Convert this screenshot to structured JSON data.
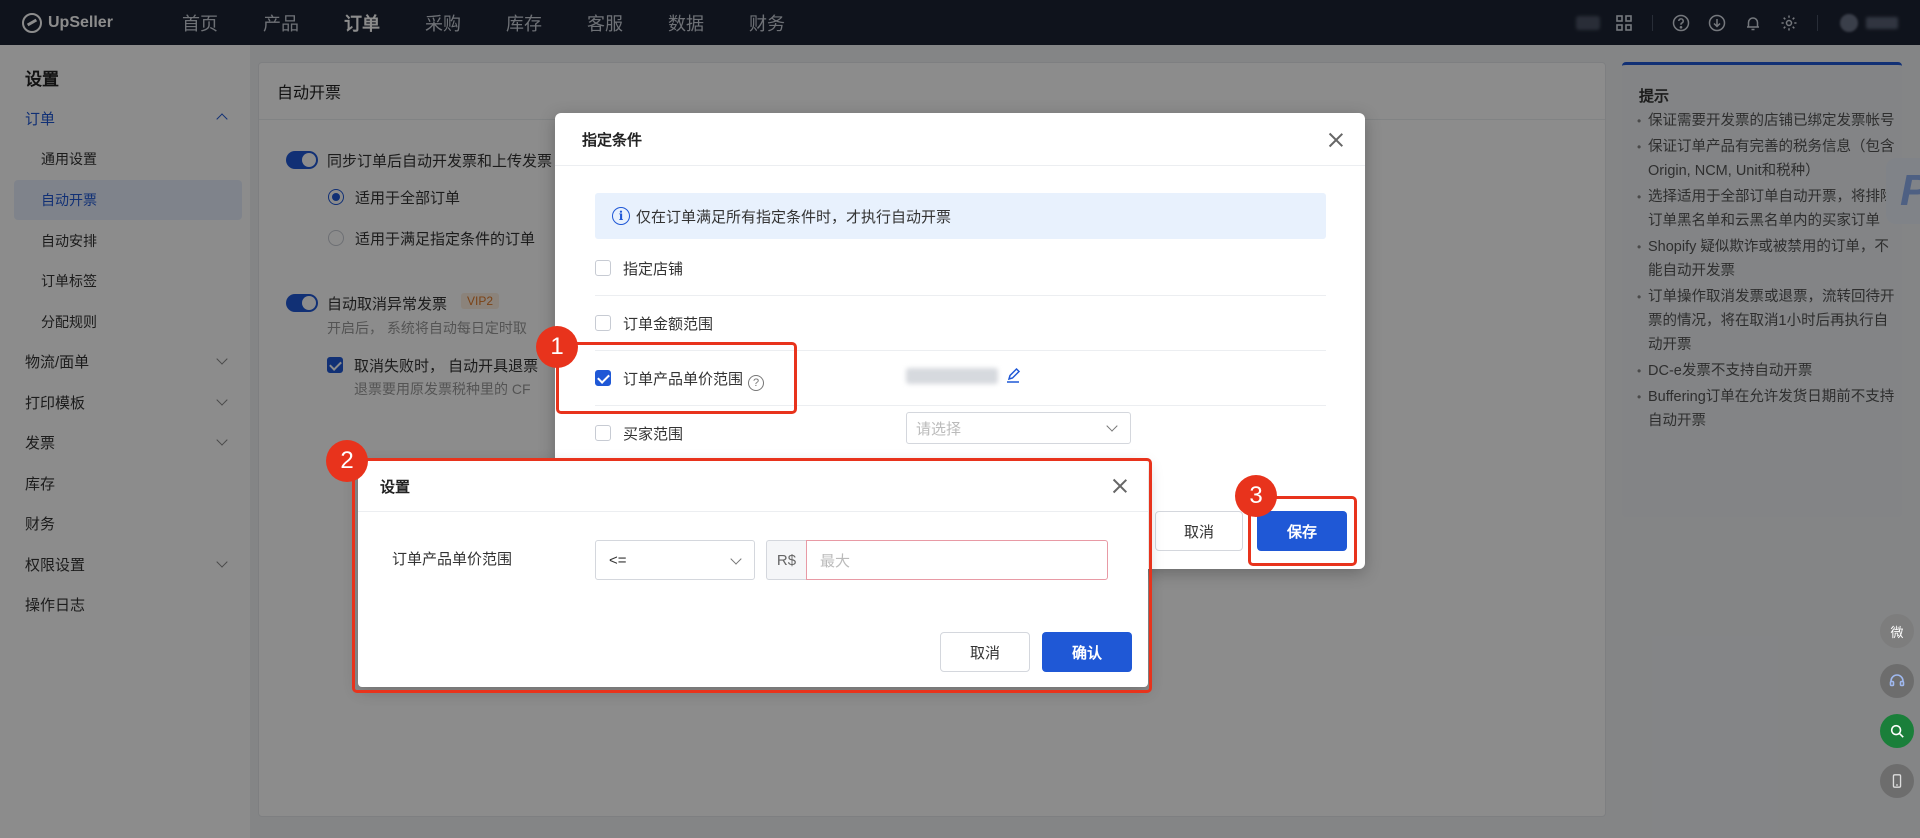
{
  "topnav": {
    "brand": "UpSeller",
    "items": [
      "首页",
      "产品",
      "订单",
      "采购",
      "库存",
      "客服",
      "数据",
      "财务"
    ],
    "active_index": 2
  },
  "sidebar": {
    "title": "设置",
    "items": [
      {
        "label": "订单",
        "expanded": true,
        "children": [
          "通用设置",
          "自动开票",
          "自动安排",
          "订单标签",
          "分配规则"
        ],
        "active_child": "自动开票"
      },
      {
        "label": "物流/面单",
        "expandable": true
      },
      {
        "label": "打印模板",
        "expandable": true
      },
      {
        "label": "发票",
        "expandable": true
      },
      {
        "label": "库存"
      },
      {
        "label": "财务"
      },
      {
        "label": "权限设置",
        "expandable": true
      },
      {
        "label": "操作日志"
      }
    ]
  },
  "main": {
    "title": "自动开票",
    "sync_toggle_label": "同步订单后自动开发票和上传发票",
    "radio_all": "适用于全部订单",
    "radio_cond": "适用于满足指定条件的订单",
    "cancel_toggle_label": "自动取消异常发票",
    "vip_badge": "VIP2",
    "cancel_desc": "开启后， 系统将自动每日定时取",
    "refund_check_label": "取消失败时， 自动开具退票",
    "refund_desc": "退票要用原发票税种里的 CF"
  },
  "tips": {
    "title": "提示",
    "items": [
      "保证需要开发票的店铺已绑定发票帐号",
      "保证订单产品有完善的税务信息（包含Origin, NCM, Unit和税种）",
      "选择适用于全部订单自动开票，将排除订单黑名单和云黑名单内的买家订单",
      "Shopify 疑似欺诈或被禁用的订单，不能自动开发票",
      "订单操作取消发票或退票，流转回待开票的情况，将在取消1小时后再执行自动开票",
      "DC-e发票不支持自动开票",
      "Buffering订单在允许发货日期前不支持自动开票"
    ]
  },
  "dialog_conditions": {
    "title": "指定条件",
    "info": "仅在订单满足所有指定条件时，才执行自动开票",
    "rows": [
      {
        "label": "指定店铺",
        "checked": false
      },
      {
        "label": "订单金额范围",
        "checked": false
      },
      {
        "label": "订单产品单价范围",
        "checked": true
      },
      {
        "label": "买家范围",
        "checked": false
      }
    ],
    "buyer_placeholder": "请选择",
    "cancel": "取消",
    "save": "保存"
  },
  "dialog_settings": {
    "title": "设置",
    "field_label": "订单产品单价范围",
    "operator": "<=",
    "currency": "R$",
    "max_placeholder": "最大",
    "cancel": "取消",
    "confirm": "确认"
  },
  "annotations": [
    "1",
    "2",
    "3"
  ],
  "colors": {
    "accent": "#1f58d6",
    "annotation": "#e8331c",
    "nav_bg": "#1d2434"
  }
}
